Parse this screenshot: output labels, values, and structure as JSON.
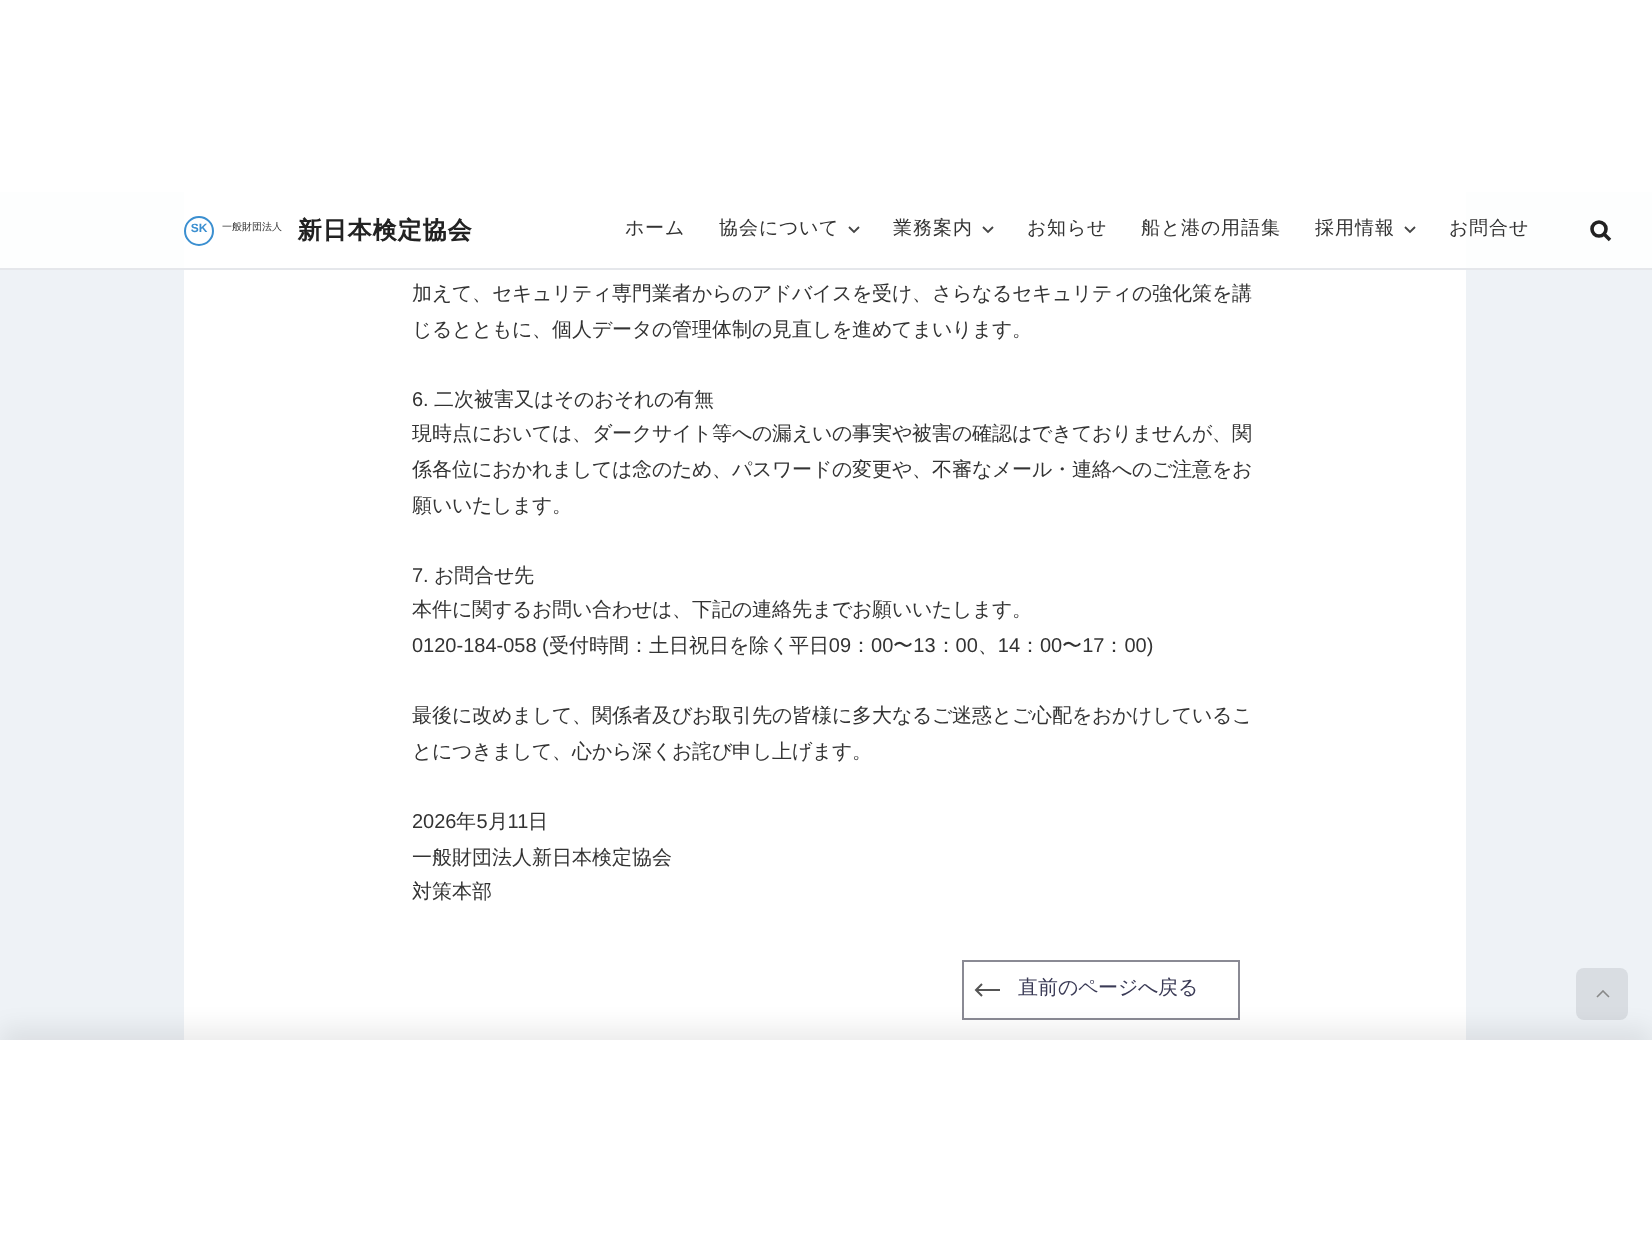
{
  "header": {
    "logo_mark": "SK",
    "org_type": "一般財団法人",
    "org_name": "新日本検定協会",
    "nav": [
      {
        "label": "ホーム",
        "has_dropdown": false
      },
      {
        "label": "協会について",
        "has_dropdown": true
      },
      {
        "label": "業務案内",
        "has_dropdown": true
      },
      {
        "label": "お知らせ",
        "has_dropdown": false
      },
      {
        "label": "船と港の用語集",
        "has_dropdown": false
      },
      {
        "label": "採用情報",
        "has_dropdown": true
      },
      {
        "label": "お問合せ",
        "has_dropdown": false
      }
    ]
  },
  "article": {
    "blocks": [
      [
        "加えて、セキュリティ専門業者からのアドバイスを受け、さらなるセキュリティの強化策を講じるとともに、個人データの管理体制の見直しを進めてまいります。"
      ],
      [
        "6. 二次被害又はそのおそれの有無",
        "現時点においては、ダークサイト等への漏えいの事実や被害の確認はできておりませんが、関係各位におかれましては念のため、パスワードの変更や、不審なメール・連絡へのご注意をお願いいたします。"
      ],
      [
        "7. お問合せ先",
        "本件に関するお問い合わせは、下記の連絡先までお願いいたします。",
        "0120-184-058 (受付時間：土日祝日を除く平日09：00〜13：00、14：00〜17：00)"
      ],
      [
        "最後に改めまして、関係者及びお取引先の皆様に多大なるご迷惑とご心配をおかけしていることにつきまして、心から深くお詫び申し上げます。"
      ],
      [
        "2026年5月11日",
        "一般財団法人新日本検定協会",
        "対策本部"
      ]
    ],
    "back_button": {
      "label": "直前のページへ戻る"
    }
  }
}
